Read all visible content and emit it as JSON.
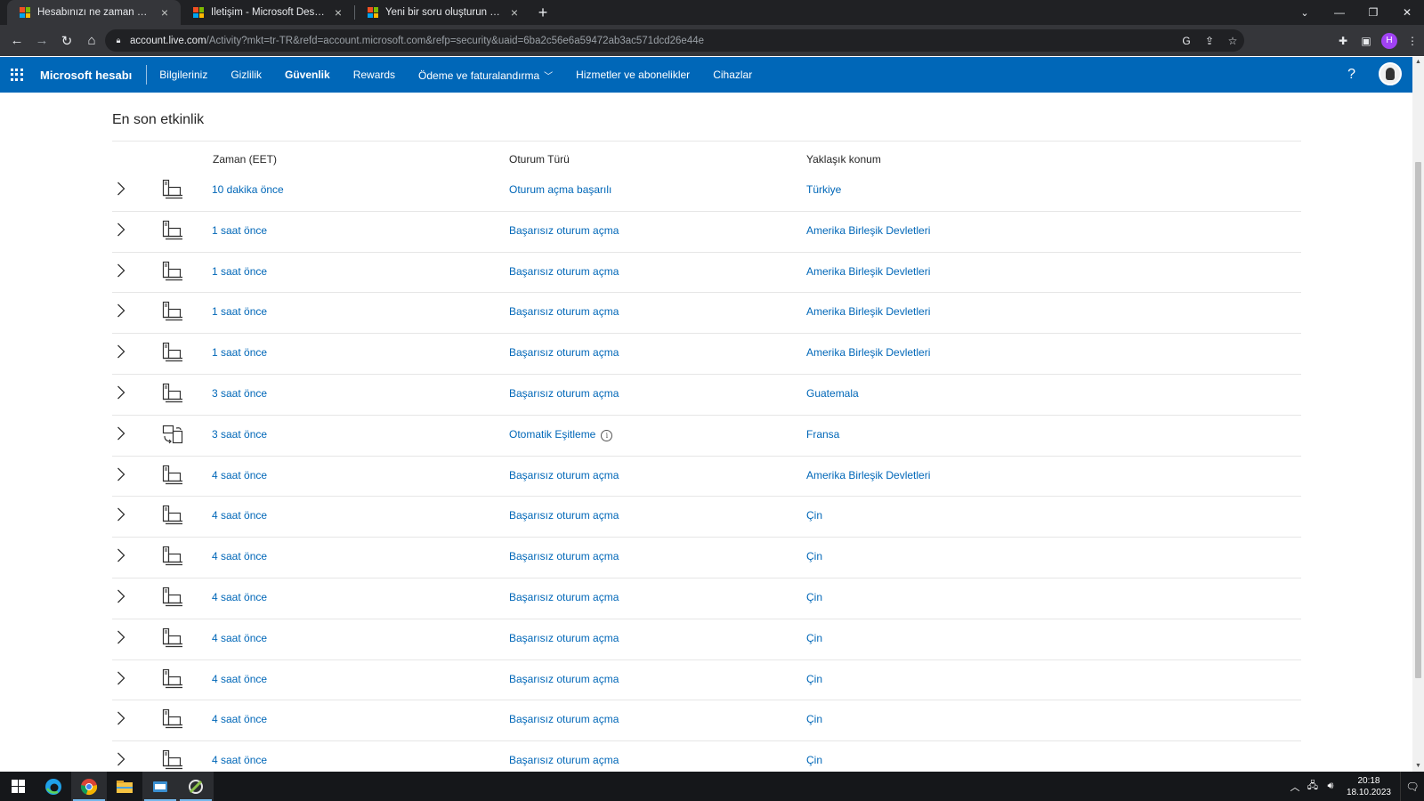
{
  "browser": {
    "tabs": [
      {
        "title": "Hesabınızı ne zaman ve nerede k",
        "active": true
      },
      {
        "title": "İletişim - Microsoft Desteği",
        "active": false
      },
      {
        "title": "Yeni bir soru oluşturun veya bir t",
        "active": false
      }
    ],
    "url_host": "account.live.com",
    "url_rest": "/Activity?mkt=tr-TR&refd=account.microsoft.com&refp=security&uaid=6ba2c56e6a59472ab3ac571dcd26e44e",
    "profile_initial": "H"
  },
  "header": {
    "brand": "Microsoft hesabı",
    "nav": [
      {
        "label": "Bilgileriniz",
        "bold": false
      },
      {
        "label": "Gizlilik",
        "bold": false
      },
      {
        "label": "Güvenlik",
        "bold": true
      },
      {
        "label": "Rewards",
        "bold": false
      },
      {
        "label": "Ödeme ve faturalandırma",
        "bold": false,
        "dropdown": true
      },
      {
        "label": "Hizmetler ve abonelikler",
        "bold": false
      },
      {
        "label": "Cihazlar",
        "bold": false
      }
    ],
    "help": "?"
  },
  "activity": {
    "title": "En son etkinlik",
    "columns": {
      "time": "Zaman (EET)",
      "type": "Oturum Türü",
      "location": "Yaklaşık konum"
    },
    "rows": [
      {
        "time": "10 dakika önce",
        "type": "Oturum açma başarılı",
        "location": "Türkiye",
        "icon": "computer-icon"
      },
      {
        "time": "1 saat önce",
        "type": "Başarısız oturum açma",
        "location": "Amerika Birleşik Devletleri",
        "icon": "computer-icon"
      },
      {
        "time": "1 saat önce",
        "type": "Başarısız oturum açma",
        "location": "Amerika Birleşik Devletleri",
        "icon": "computer-icon"
      },
      {
        "time": "1 saat önce",
        "type": "Başarısız oturum açma",
        "location": "Amerika Birleşik Devletleri",
        "icon": "computer-icon"
      },
      {
        "time": "1 saat önce",
        "type": "Başarısız oturum açma",
        "location": "Amerika Birleşik Devletleri",
        "icon": "computer-icon"
      },
      {
        "time": "3 saat önce",
        "type": "Başarısız oturum açma",
        "location": "Guatemala",
        "icon": "computer-icon"
      },
      {
        "time": "3 saat önce",
        "type": "Otomatik Eşitleme",
        "location": "Fransa",
        "icon": "sync-icon",
        "info": true
      },
      {
        "time": "4 saat önce",
        "type": "Başarısız oturum açma",
        "location": "Amerika Birleşik Devletleri",
        "icon": "computer-icon"
      },
      {
        "time": "4 saat önce",
        "type": "Başarısız oturum açma",
        "location": "Çin",
        "icon": "computer-icon"
      },
      {
        "time": "4 saat önce",
        "type": "Başarısız oturum açma",
        "location": "Çin",
        "icon": "computer-icon"
      },
      {
        "time": "4 saat önce",
        "type": "Başarısız oturum açma",
        "location": "Çin",
        "icon": "computer-icon"
      },
      {
        "time": "4 saat önce",
        "type": "Başarısız oturum açma",
        "location": "Çin",
        "icon": "computer-icon"
      },
      {
        "time": "4 saat önce",
        "type": "Başarısız oturum açma",
        "location": "Çin",
        "icon": "computer-icon"
      },
      {
        "time": "4 saat önce",
        "type": "Başarısız oturum açma",
        "location": "Çin",
        "icon": "computer-icon"
      },
      {
        "time": "4 saat önce",
        "type": "Başarısız oturum açma",
        "location": "Çin",
        "icon": "computer-icon"
      }
    ]
  },
  "taskbar": {
    "time": "20:18",
    "date": "18.10.2023",
    "apps": [
      "start-icon",
      "edge-icon",
      "chrome-icon",
      "file-explorer-icon",
      "app-icon",
      "app-icon"
    ]
  },
  "colors": {
    "accent": "#0067b8",
    "link": "#0067b8",
    "chrome_dark": "#202124",
    "chrome_toolbar": "#35363a"
  }
}
